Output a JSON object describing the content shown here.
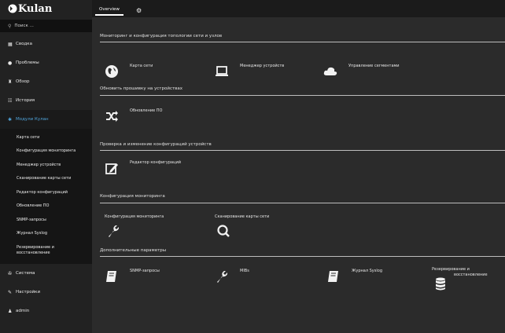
{
  "app": {
    "logo_text": "Kulan"
  },
  "search": {
    "placeholder": "Поиск ..."
  },
  "sidebar": {
    "items": [
      {
        "label": "Сводка"
      },
      {
        "label": "Проблемы"
      },
      {
        "label": "Обзор"
      },
      {
        "label": "История"
      },
      {
        "label": "Модули Кулан"
      },
      {
        "label": "Система"
      },
      {
        "label": "Настройки"
      },
      {
        "label": "admin"
      }
    ],
    "subitems": [
      {
        "label": "Карта сети"
      },
      {
        "label": "Конфигурация мониторинга"
      },
      {
        "label": "Менеджер устройств"
      },
      {
        "label": "Сканирование карты сети"
      },
      {
        "label": "Редактор конфигураций"
      },
      {
        "label": "Обновление ПО"
      },
      {
        "label": "SNMP-запросы"
      },
      {
        "label": "Журнал Syslog"
      },
      {
        "label_line1": "Резервирование и",
        "label_line2": "восстановление"
      }
    ]
  },
  "tabs": {
    "overview": "Overview",
    "settings": "⚙"
  },
  "sections": [
    {
      "title": "Мониторинг и конфигурация топологии сети и узлов",
      "tiles": [
        {
          "label": "Карта сети"
        },
        {
          "label": "Менеджер устройств"
        },
        {
          "label": "Управление сегментами"
        }
      ]
    },
    {
      "title": "Обновить прошивку на устройствах",
      "tiles": [
        {
          "label": "Обновление ПО"
        }
      ]
    },
    {
      "title": "Проверка и изменение конфигураций устройств",
      "tiles": [
        {
          "label": "Редактор конфигураций"
        }
      ]
    },
    {
      "title": "Конфигурация мониторинга",
      "tiles": [
        {
          "label": "Конфигурация мониторинга"
        },
        {
          "label": "Сканирование карты сети"
        }
      ]
    },
    {
      "title": "Дополнительные параметры",
      "tiles": [
        {
          "label": "SNMP-запросы"
        },
        {
          "label": "MIBs"
        },
        {
          "label": "Журнал Syslog"
        },
        {
          "label_line1": "Резервирование и",
          "label_line2": "восстановление"
        }
      ]
    }
  ],
  "colors": {
    "accent": "#4fa3d9",
    "background": "#2b2b2b",
    "sidebar": "#222222"
  }
}
